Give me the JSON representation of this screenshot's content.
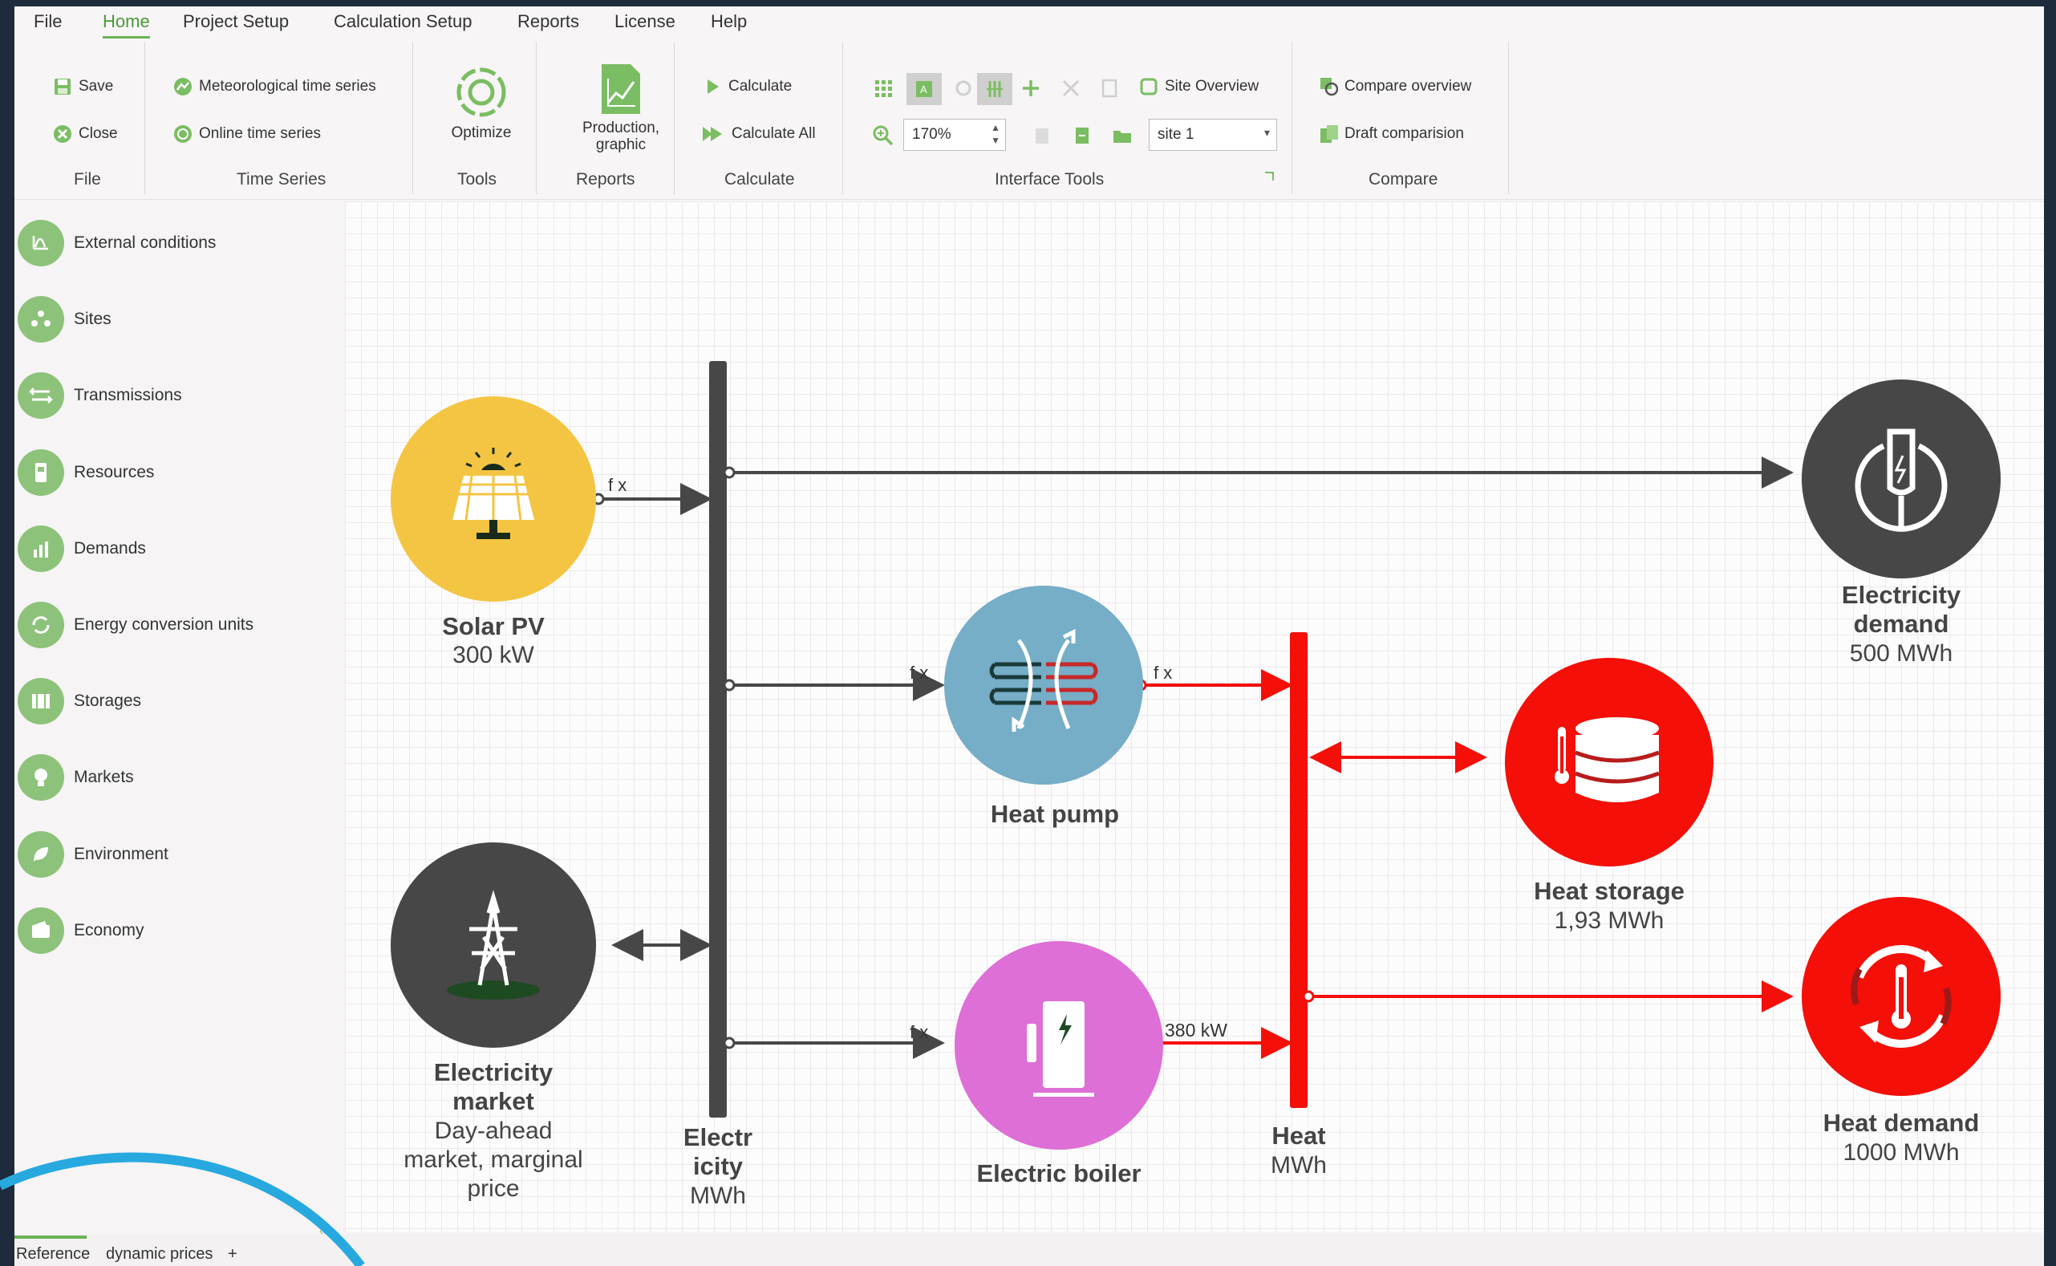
{
  "menu": [
    "File",
    "Home",
    "Project Setup",
    "Calculation Setup",
    "Reports",
    "License",
    "Help"
  ],
  "ribbon": {
    "file": {
      "save": "Save",
      "close": "Close",
      "label": "File"
    },
    "time_series": {
      "meteo": "Meteorological time series",
      "online": "Online time series",
      "label": "Time Series"
    },
    "tools": {
      "optimize": "Optimize",
      "label": "Tools"
    },
    "reports": {
      "production_line1": "Production,",
      "production_line2": "graphic",
      "label": "Reports"
    },
    "calculate": {
      "calculate": "Calculate",
      "calculate_all": "Calculate All",
      "label": "Calculate"
    },
    "interface": {
      "site_overview": "Site Overview",
      "zoom": "170%",
      "site": "site 1",
      "label": "Interface Tools"
    },
    "compare": {
      "compare_overview": "Compare overview",
      "draft": "Draft comparision",
      "label": "Compare"
    }
  },
  "sidebar": [
    {
      "label": "External conditions",
      "icon": "chart-curve-icon"
    },
    {
      "label": "Sites",
      "icon": "sites-icon"
    },
    {
      "label": "Transmissions",
      "icon": "transmission-arrows-icon"
    },
    {
      "label": "Resources",
      "icon": "resource-tank-icon"
    },
    {
      "label": "Demands",
      "icon": "demand-bars-icon"
    },
    {
      "label": "Energy conversion units",
      "icon": "conversion-cycle-icon"
    },
    {
      "label": "Storages",
      "icon": "storage-icon"
    },
    {
      "label": "Markets",
      "icon": "market-bulb-icon"
    },
    {
      "label": "Environment",
      "icon": "leaf-icon"
    },
    {
      "label": "Economy",
      "icon": "wallet-icon"
    }
  ],
  "diagram": {
    "solar": {
      "name": "Solar PV",
      "value": "300 kW",
      "color": "#f4c543"
    },
    "elec_market": {
      "name1": "Electricity",
      "name2": "market",
      "d1": "Day-ahead",
      "d2": "market, marginal",
      "d3": "price",
      "color": "#474747"
    },
    "elec_bus": {
      "n1": "Electr",
      "n2": "icity",
      "unit": "MWh"
    },
    "heat_pump": {
      "name": "Heat pump",
      "color": "#76adc7"
    },
    "boiler": {
      "name": "Electric boiler",
      "color": "#dd6fd6"
    },
    "heat_bus": {
      "name": "Heat",
      "unit": "MWh"
    },
    "heat_storage": {
      "name": "Heat storage",
      "value": "1,93 MWh",
      "color": "#f40f08"
    },
    "elec_demand": {
      "name1": "Electricity",
      "name2": "demand",
      "value": "500 MWh",
      "color": "#474747"
    },
    "heat_demand": {
      "name": "Heat demand",
      "value": "1000 MWh",
      "color": "#f40f08"
    },
    "labels": {
      "fx": "f x",
      "boiler_power": "380 kW"
    }
  },
  "tabs": {
    "reference": "Reference",
    "dynamic": "dynamic prices",
    "add": "+"
  }
}
